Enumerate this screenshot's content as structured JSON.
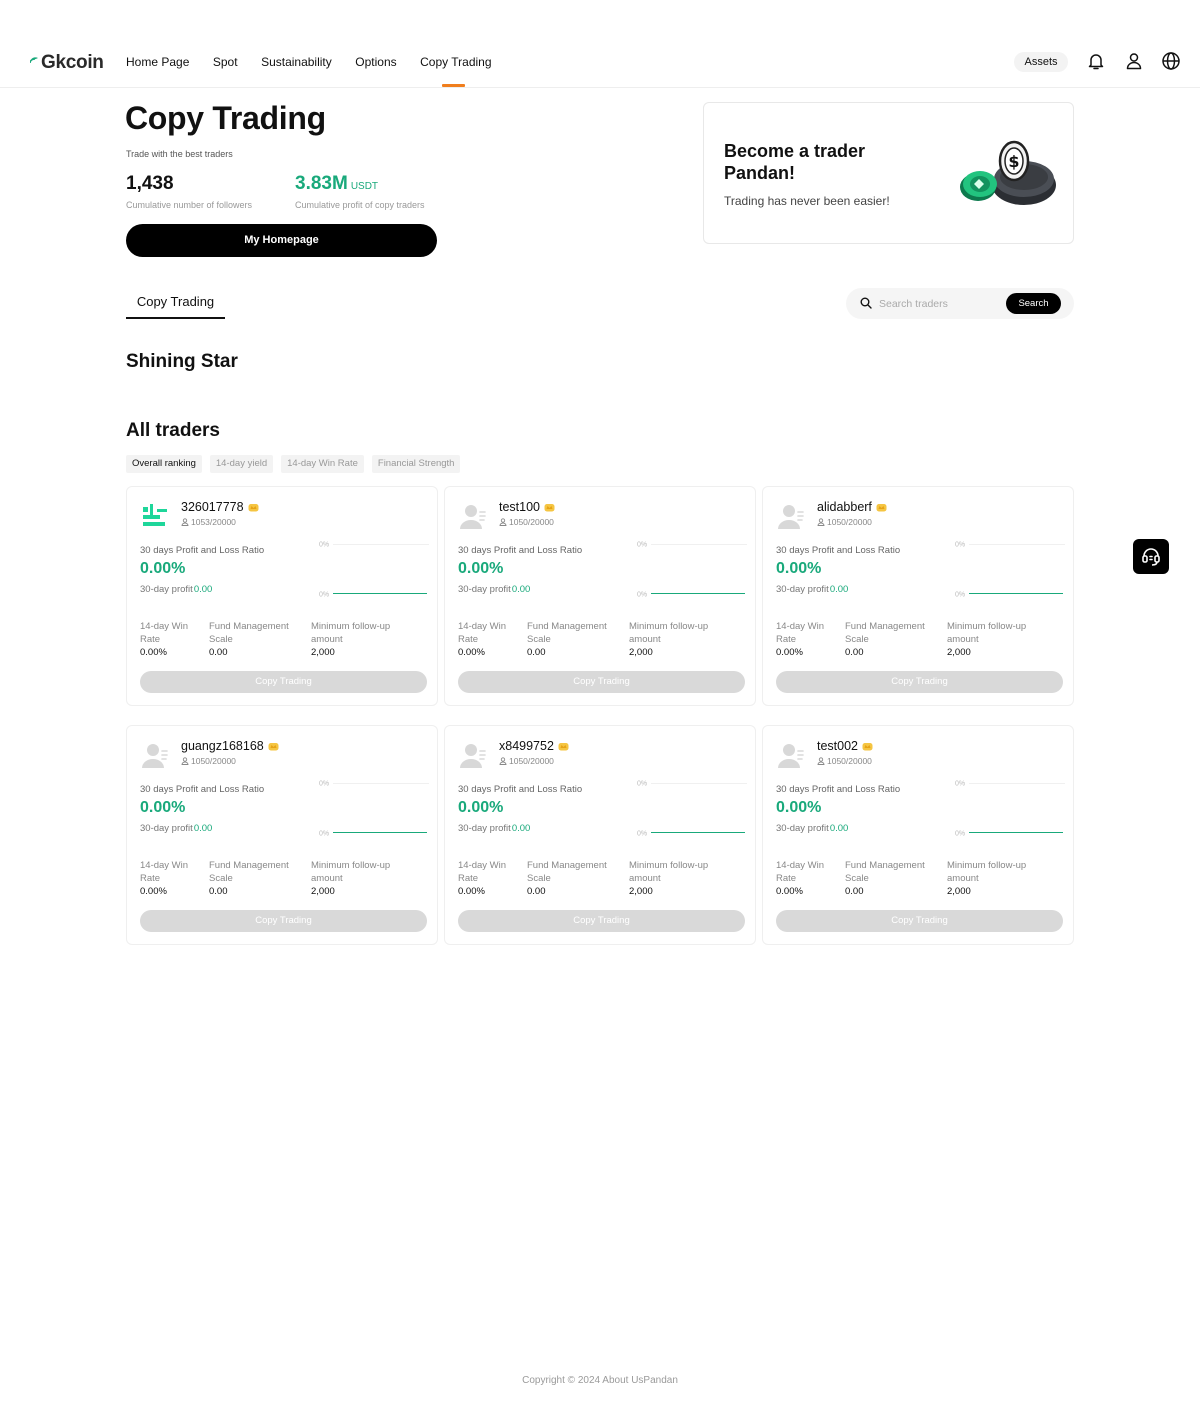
{
  "header": {
    "logo_text": "Gkcoin",
    "nav": [
      "Home Page",
      "Spot",
      "Sustainability",
      "Options",
      "Copy Trading"
    ],
    "active_nav": "Copy Trading",
    "assets_label": "Assets",
    "icons": [
      "bell-icon",
      "user-icon",
      "globe-icon"
    ]
  },
  "hero": {
    "title": "Copy Trading",
    "subtitle": "Trade with the best traders",
    "stats": [
      {
        "value": "1,438",
        "unit": "",
        "label": "Cumulative number of followers"
      },
      {
        "value": "3.83M",
        "unit": "USDT",
        "label": "Cumulative profit of copy traders"
      }
    ],
    "homepage_button": "My Homepage"
  },
  "promo": {
    "title": "Become a trader Pandan!",
    "subtitle": "Trading has never been easier!"
  },
  "tabs": {
    "active": "Copy Trading"
  },
  "search": {
    "placeholder": "Search traders",
    "button": "Search"
  },
  "sections": {
    "shining_star": "Shining Star",
    "all_traders": "All traders"
  },
  "filters": [
    "Overall ranking",
    "14-day yield",
    "14-day Win Rate",
    "Financial Strength"
  ],
  "card_labels": {
    "ratio": "30 days Profit and Loss Ratio",
    "profit_prefix": "30-day profit",
    "win_rate": "14-day Win Rate",
    "fund_scale": "Fund Management Scale",
    "min_follow": "Minimum follow-up amount",
    "copy_button": "Copy Trading",
    "chart_top_tick": "0%",
    "chart_bottom_tick": "0%"
  },
  "traders": [
    {
      "name": "326017778",
      "followers": "1053/20000",
      "ratio": "0.00%",
      "profit": "0.00",
      "win_rate": "0.00%",
      "fund_scale": "0.00",
      "min_follow": "2,000",
      "avatar": "logo"
    },
    {
      "name": "test100",
      "followers": "1050/20000",
      "ratio": "0.00%",
      "profit": "0.00",
      "win_rate": "0.00%",
      "fund_scale": "0.00",
      "min_follow": "2,000",
      "avatar": "default"
    },
    {
      "name": "alidabberf",
      "followers": "1050/20000",
      "ratio": "0.00%",
      "profit": "0.00",
      "win_rate": "0.00%",
      "fund_scale": "0.00",
      "min_follow": "2,000",
      "avatar": "default"
    },
    {
      "name": "guangz168168",
      "followers": "1050/20000",
      "ratio": "0.00%",
      "profit": "0.00",
      "win_rate": "0.00%",
      "fund_scale": "0.00",
      "min_follow": "2,000",
      "avatar": "default"
    },
    {
      "name": "x8499752",
      "followers": "1050/20000",
      "ratio": "0.00%",
      "profit": "0.00",
      "win_rate": "0.00%",
      "fund_scale": "0.00",
      "min_follow": "2,000",
      "avatar": "default"
    },
    {
      "name": "test002",
      "followers": "1050/20000",
      "ratio": "0.00%",
      "profit": "0.00",
      "win_rate": "0.00%",
      "fund_scale": "0.00",
      "min_follow": "2,000",
      "avatar": "default"
    }
  ],
  "footer": {
    "text": "Copyright © 2024 About UsPandan"
  },
  "colors": {
    "accent_green": "#19a97b",
    "nav_underline": "#f07e1d",
    "button_dark": "#000000",
    "disabled_button": "#d9d9d9"
  }
}
